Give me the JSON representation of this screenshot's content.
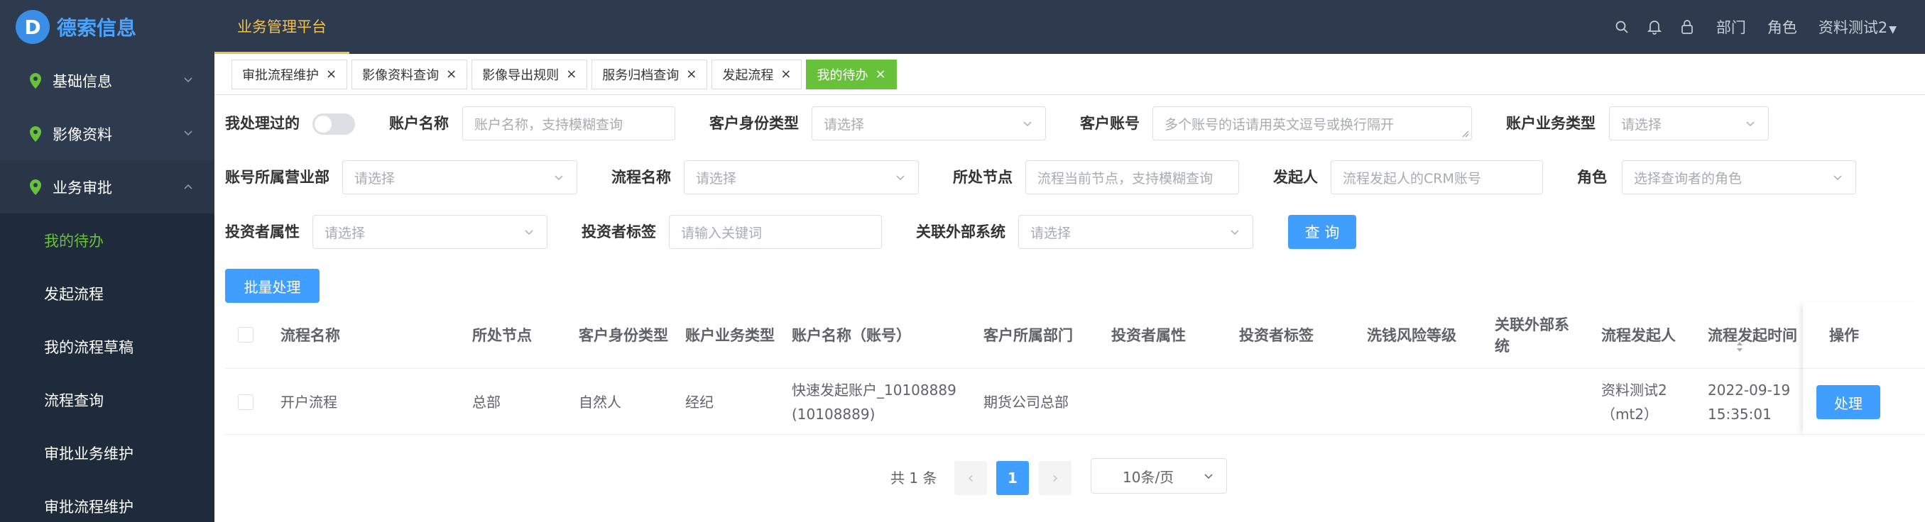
{
  "brand": {
    "logo_mark": "D",
    "name": "德索信息"
  },
  "topbar": {
    "platform": "业务管理平台",
    "icons": [
      "search-icon",
      "bell-icon",
      "lock-icon"
    ],
    "dept": "部门",
    "role": "角色",
    "user": "资料测试2"
  },
  "sidebar": {
    "menus": [
      {
        "label": "基础信息",
        "icon": "location-pin-icon"
      },
      {
        "label": "影像资料",
        "icon": "location-pin-icon"
      },
      {
        "label": "业务审批",
        "icon": "location-pin-icon"
      }
    ],
    "sub_items": [
      {
        "label": "我的待办",
        "active": true
      },
      {
        "label": "发起流程"
      },
      {
        "label": "我的流程草稿"
      },
      {
        "label": "流程查询"
      },
      {
        "label": "审批业务维护"
      },
      {
        "label": "审批流程维护"
      }
    ]
  },
  "tabs": [
    {
      "label": "审批流程维护"
    },
    {
      "label": "影像资料查询"
    },
    {
      "label": "影像导出规则"
    },
    {
      "label": "服务归档查询"
    },
    {
      "label": "发起流程"
    },
    {
      "label": "我的待办",
      "active": true
    }
  ],
  "filters": {
    "processed_by_me": "我处理过的",
    "account_name": {
      "label": "账户名称",
      "placeholder": "账户名称，支持模糊查询"
    },
    "client_identity_type": {
      "label": "客户身份类型",
      "placeholder": "请选择"
    },
    "client_account": {
      "label": "客户账号",
      "placeholder": "多个账号的话请用英文逗号或换行隔开"
    },
    "account_business_type": {
      "label": "账户业务类型",
      "placeholder": "请选择"
    },
    "account_branch": {
      "label": "账号所属营业部",
      "placeholder": "请选择"
    },
    "process_name": {
      "label": "流程名称",
      "placeholder": "请选择"
    },
    "current_node": {
      "label": "所处节点",
      "placeholder": "流程当前节点，支持模糊查询"
    },
    "initiator": {
      "label": "发起人",
      "placeholder": "流程发起人的CRM账号"
    },
    "role": {
      "label": "角色",
      "placeholder": "选择查询者的角色"
    },
    "investor_attribute": {
      "label": "投资者属性",
      "placeholder": "请选择"
    },
    "investor_tag": {
      "label": "投资者标签",
      "placeholder": "请输入关键词"
    },
    "external_system": {
      "label": "关联外部系统",
      "placeholder": "请选择"
    },
    "query_button": "查 询"
  },
  "batch_button": "批量处理",
  "table": {
    "headers": [
      "流程名称",
      "所处节点",
      "客户身份类型",
      "账户业务类型",
      "账户名称（账号）",
      "客户所属部门",
      "投资者属性",
      "投资者标签",
      "洗钱风险等级",
      "关联外部系统",
      "流程发起人",
      "流程发起时间",
      "操作"
    ],
    "rows": [
      {
        "process_name": "开户流程",
        "node": "总部",
        "identity_type": "自然人",
        "business_type": "经纪",
        "account_name": "快速发起账户_10108889",
        "account_no": "(10108889)",
        "department": "期货公司总部",
        "investor_attribute": "",
        "investor_tag": "",
        "aml_level": "",
        "external_system": "",
        "initiator": "资料测试2",
        "initiator_id": "（mt2）",
        "date": "2022-09-19",
        "time": "15:35:01",
        "action": "处理"
      }
    ]
  },
  "pagination": {
    "total": "共 1 条",
    "current": "1",
    "page_size": "10条/页"
  },
  "colors": {
    "sidebar": "#2e3a4d",
    "accent": "#409eff",
    "active": "#67c23a",
    "platform": "#f5c04a"
  }
}
